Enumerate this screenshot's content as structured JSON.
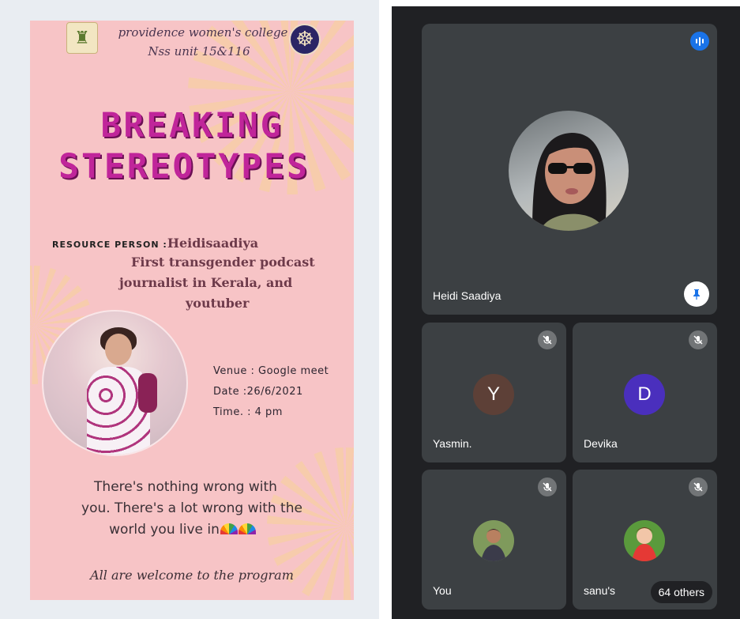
{
  "poster": {
    "college_name": "providence women's college",
    "nss_unit": "Nss unit 15&116",
    "headline_line1": "BREAKING",
    "headline_line2": "STEREOTYPES",
    "resource_label": "RESOURCE PERSON :",
    "resource_name": "Heidisaadiya",
    "description_lines": [
      "First transgender  podcast",
      "journalist in Kerala,  and",
      "youtuber"
    ],
    "venue": "Venue : Google meet",
    "date": "Date  :26/6/2021",
    "time": "Time.  : 4 pm",
    "quote_lines": [
      "There's nothing wrong with",
      "you. There's a lot wrong with the",
      "world you live in"
    ],
    "welcome": "All are welcome to the program"
  },
  "meeting": {
    "main_participant": {
      "name": "Heidi Saadiya",
      "speaking_icon": "audio-wave-icon",
      "pin_icon": "pin-icon"
    },
    "participants": [
      {
        "name": "Yasmin.",
        "initial": "Y",
        "avatar_color": "#5d4037",
        "muted": true
      },
      {
        "name": "Devika",
        "initial": "D",
        "avatar_color": "#4a2fbd",
        "muted": true
      },
      {
        "name": "You",
        "muted": true
      },
      {
        "name": "sanu's",
        "muted": true
      }
    ],
    "others_count": "64 others"
  },
  "colors": {
    "poster_bg": "#f7c4c6",
    "headline": "#c0259a",
    "meet_bg": "#202124",
    "tile_bg": "#3c4043",
    "accent_blue": "#1a73e8"
  }
}
